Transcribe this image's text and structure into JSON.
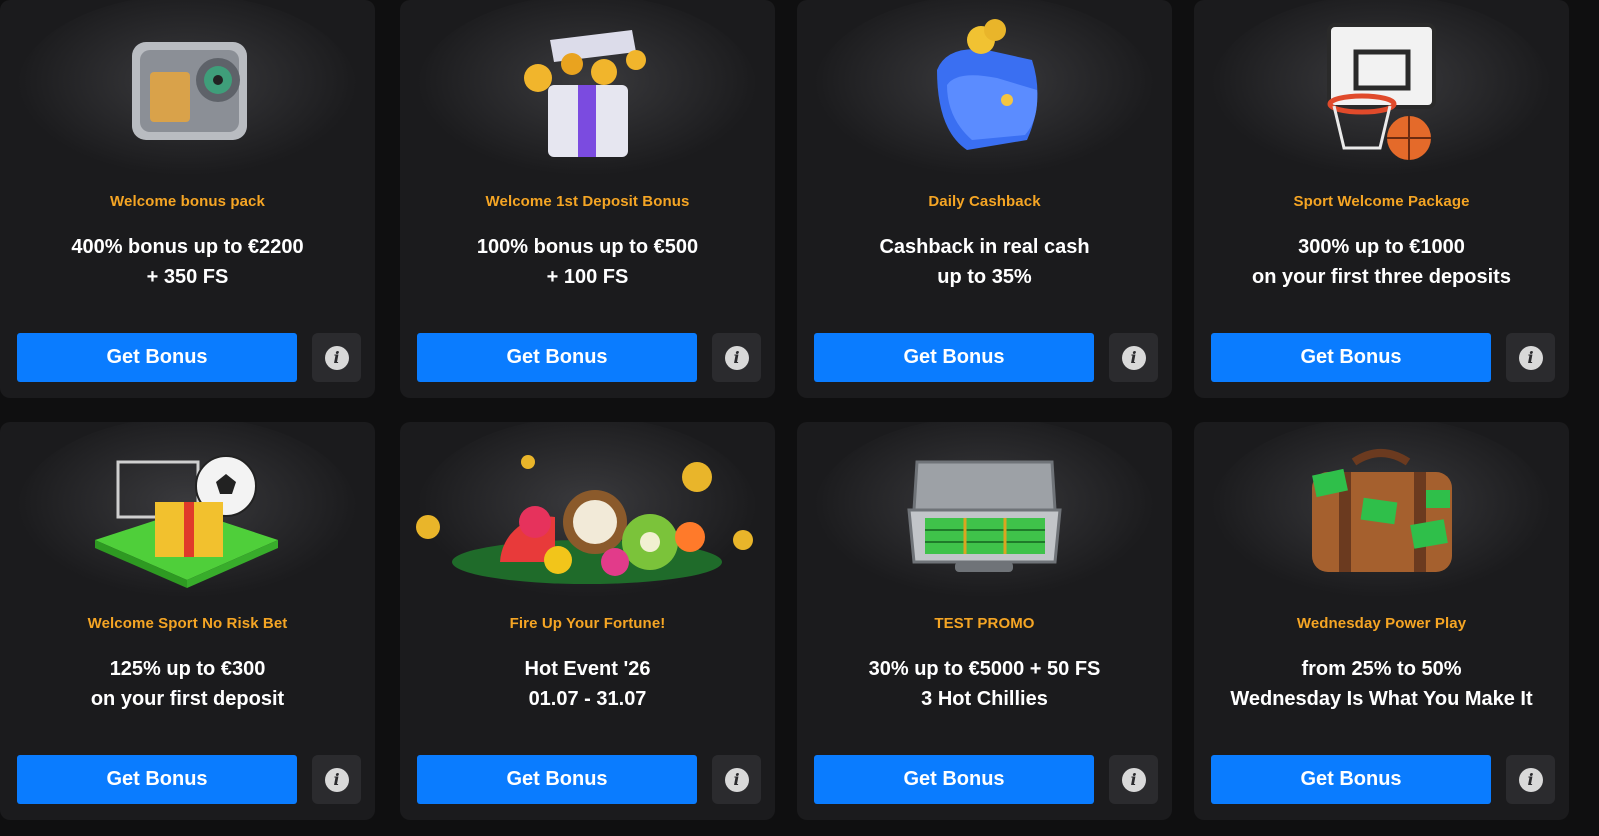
{
  "colors": {
    "card_bg": "#1b1b1d",
    "title": "#f5a524",
    "button": "#0a7cff",
    "info_bg": "#2b2b2e"
  },
  "cards": [
    {
      "title": "Welcome bonus pack",
      "line1": "400% bonus up to €2200",
      "line2": "+ 350 FS",
      "button": "Get Bonus",
      "icon": "safe-icon"
    },
    {
      "title": "Welcome 1st Deposit Bonus",
      "line1": "100% bonus up to €500",
      "line2": "+ 100 FS",
      "button": "Get Bonus",
      "icon": "gift-box-coins-icon"
    },
    {
      "title": "Daily Cashback",
      "line1": "Cashback in real cash",
      "line2": "up to 35%",
      "button": "Get Bonus",
      "icon": "wallet-cashback-icon"
    },
    {
      "title": "Sport Welcome Package",
      "line1": "300% up to €1000",
      "line2": "on your first three deposits",
      "button": "Get Bonus",
      "icon": "basketball-hoop-icon"
    },
    {
      "title": "Welcome Sport No Risk Bet",
      "line1": "125% up to €300",
      "line2": "on your first deposit",
      "button": "Get Bonus",
      "icon": "football-gift-icon"
    },
    {
      "title": "Fire Up Your Fortune!",
      "line1": "Hot Event '26",
      "line2": "01.07 - 31.07",
      "button": "Get Bonus",
      "icon": "tropical-fruits-icon"
    },
    {
      "title": "TEST PROMO",
      "line1": "30% up to €5000 + 50 FS",
      "line2": "3 Hot Chillies",
      "button": "Get Bonus",
      "icon": "money-case-icon"
    },
    {
      "title": "Wednesday Power Play",
      "line1": "from 25% to 50%",
      "line2": "Wednesday Is What You Make It",
      "button": "Get Bonus",
      "icon": "money-bag-icon"
    }
  ],
  "info_icon": "i"
}
